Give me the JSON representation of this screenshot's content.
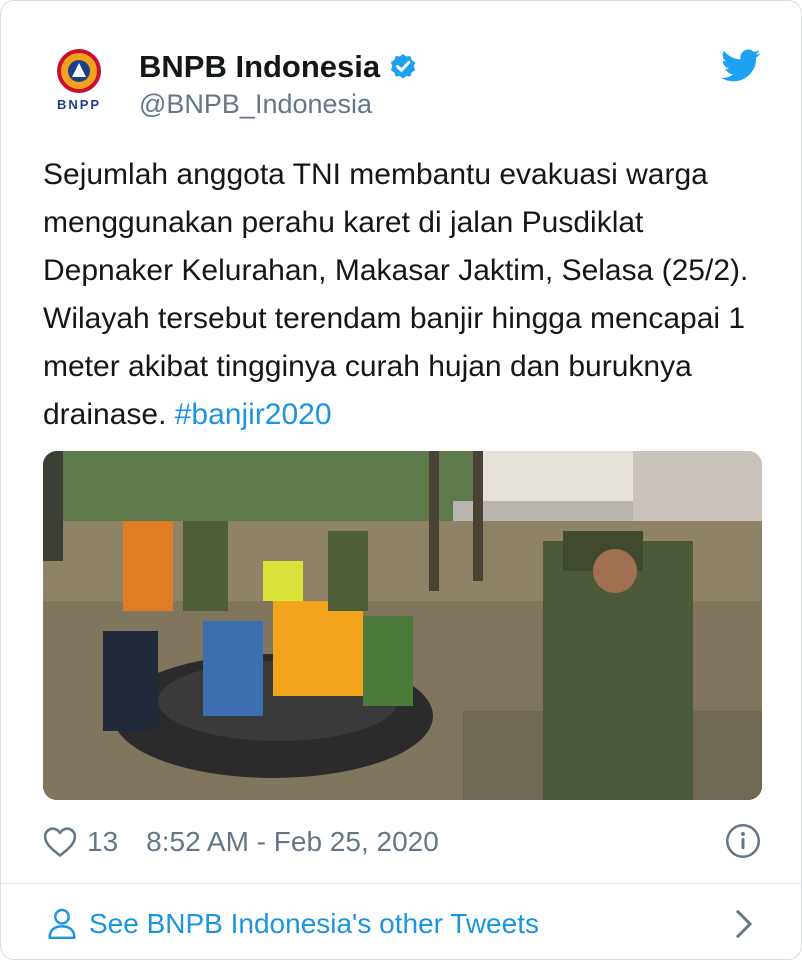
{
  "tweet": {
    "author_name": "BNPB Indonesia",
    "author_handle": "@BNPB_Indonesia",
    "avatar_text": "BNPP",
    "text_main": "Sejumlah anggota TNI membantu evakuasi warga menggunakan perahu karet di jalan Pusdiklat Depnaker Kelurahan, Makasar Jaktim, Selasa (25/2). Wilayah tersebut terendam banjir hingga mencapai 1 meter akibat tingginya curah hujan dan buruknya drainase. ",
    "hashtag": "#banjir2020",
    "likes": "13",
    "timestamp": "8:52 AM - Feb 25, 2020"
  },
  "footer": {
    "link_label": "See BNPB Indonesia's other Tweets"
  },
  "icons": {
    "verified": "verified-badge-icon",
    "bird": "twitter-bird-icon",
    "heart": "heart-icon",
    "info": "info-icon",
    "person": "person-icon",
    "chevron": "chevron-right-icon"
  },
  "colors": {
    "link": "#1b95e0",
    "secondary_text": "#657786",
    "primary_text": "#14171a"
  }
}
